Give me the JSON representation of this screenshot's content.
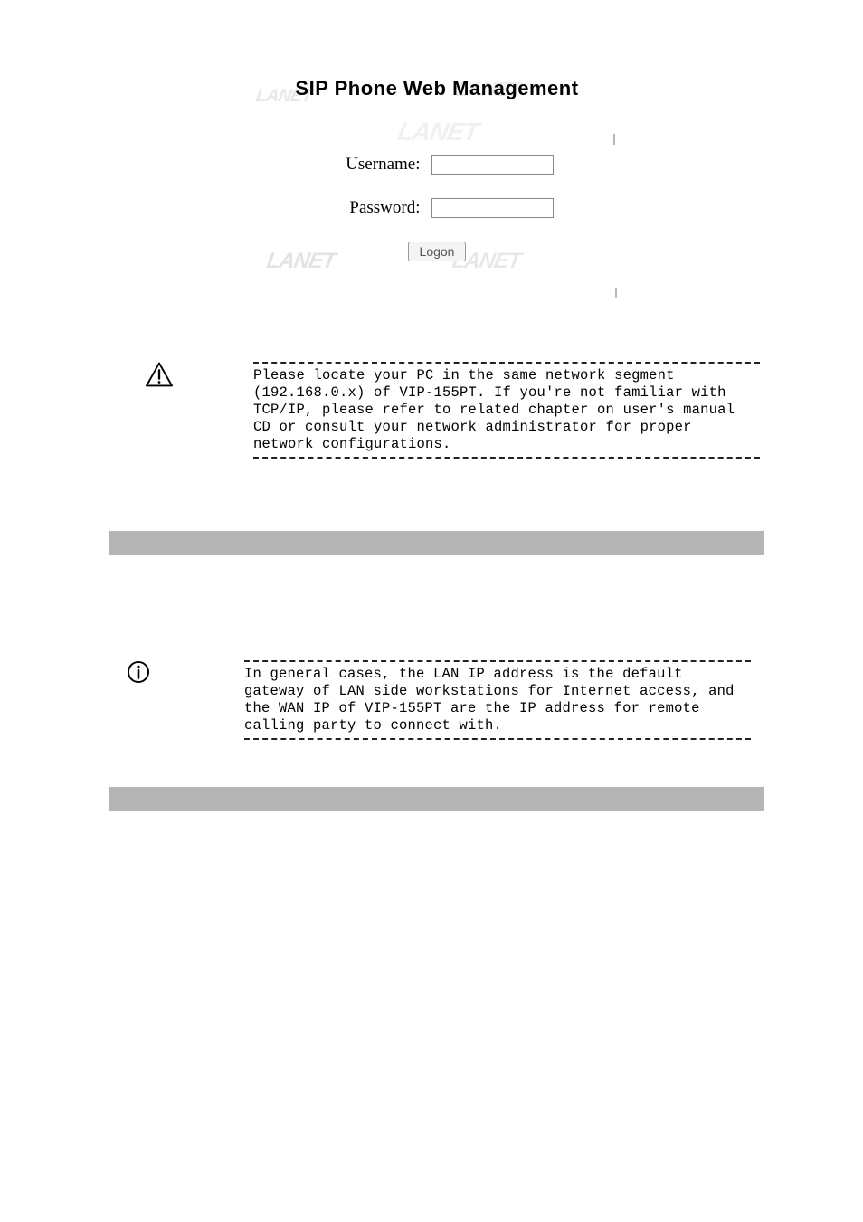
{
  "login": {
    "title": "SIP Phone Web Management",
    "username_label": "Username:",
    "password_label": "Password:",
    "username_value": "",
    "password_value": "",
    "logon_label": "Logon"
  },
  "watermarks": {
    "text": "LANET"
  },
  "callouts": {
    "warning": "Please locate your PC in the same network segment (192.168.0.x) of VIP-155PT. If you're not familiar with TCP/IP, please refer to related chapter on user's manual CD or consult your network administrator for proper network configurations.",
    "info": "In general cases, the LAN IP address is the default gateway of LAN side workstations for Internet access, and the WAN IP of VIP-155PT are the IP address for remote calling party to connect with."
  }
}
